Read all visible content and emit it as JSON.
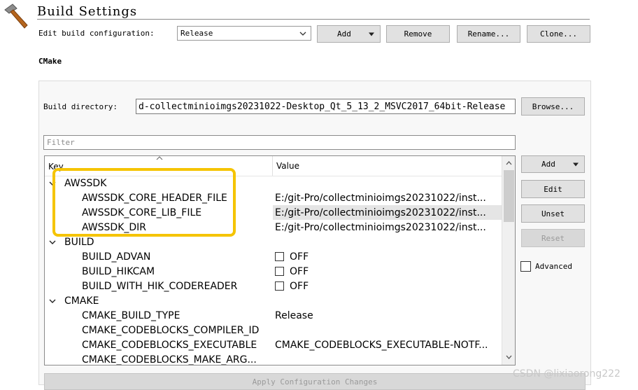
{
  "header": {
    "title": "Build Settings",
    "icon": "hammer-icon"
  },
  "config_bar": {
    "label": "Edit build configuration:",
    "selected": "Release",
    "add_label": "Add",
    "remove_label": "Remove",
    "rename_label": "Rename...",
    "clone_label": "Clone..."
  },
  "cmake": {
    "section_title": "CMake",
    "build_dir_label": "Build directory:",
    "build_dir_value": "d-collectminioimgs20231022-Desktop_Qt_5_13_2_MSVC2017_64bit-Release",
    "browse_label": "Browse...",
    "filter_placeholder": "Filter",
    "table": {
      "col_key": "Key",
      "col_value": "Value",
      "groups": [
        {
          "name": "AWSSDK",
          "rows": [
            {
              "key": "AWSSDK_CORE_HEADER_FILE",
              "value": "E:/git-Pro/collectminioimgs20231022/inst..."
            },
            {
              "key": "AWSSDK_CORE_LIB_FILE",
              "value": "E:/git-Pro/collectminioimgs20231022/inst..."
            },
            {
              "key": "AWSSDK_DIR",
              "value": "E:/git-Pro/collectminioimgs20231022/inst..."
            }
          ]
        },
        {
          "name": "BUILD",
          "rows": [
            {
              "key": "BUILD_ADVAN",
              "value": "OFF"
            },
            {
              "key": "BUILD_HIKCAM",
              "value": "OFF"
            },
            {
              "key": "BUILD_WITH_HIK_CODEREADER",
              "value": "OFF"
            }
          ]
        },
        {
          "name": "CMAKE",
          "rows": [
            {
              "key": "CMAKE_BUILD_TYPE",
              "value": "Release"
            },
            {
              "key": "CMAKE_CODEBLOCKS_COMPILER_ID",
              "value": ""
            },
            {
              "key": "CMAKE_CODEBLOCKS_EXECUTABLE",
              "value": "CMAKE_CODEBLOCKS_EXECUTABLE-NOTF..."
            },
            {
              "key": "CMAKE_CODEBLOCKS_MAKE_ARG...",
              "value": ""
            }
          ]
        }
      ]
    },
    "side_buttons": {
      "add": "Add",
      "edit": "Edit",
      "unset": "Unset",
      "reset": "Reset",
      "advanced": "Advanced"
    },
    "apply_label": "Apply Configuration Changes"
  },
  "watermark": "CSDN @lixiaorong222",
  "colors": {
    "highlight": "#f5c400",
    "selected_row": "#e5e5e5"
  }
}
